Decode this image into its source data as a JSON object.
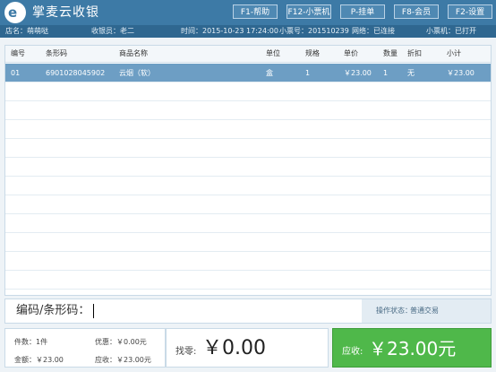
{
  "app": {
    "title": "掌麦云收银",
    "logo_icon": "logo-icon"
  },
  "function_keys": [
    {
      "label": "F1-帮助"
    },
    {
      "label": "F12-小票机"
    },
    {
      "label": "P-挂单"
    },
    {
      "label": "F8-会员"
    },
    {
      "label": "F2-设置"
    }
  ],
  "info": {
    "store": "店名：萌萌哒",
    "cashier": "收银员：老二",
    "time": "时间：2015-10-23 17:24:00",
    "ticket_no": "小票号：201510239",
    "network": "网络：已连接",
    "printer": "小票机：已打开"
  },
  "table": {
    "headers": [
      "编号",
      "条形码",
      "商品名称",
      "单位",
      "规格",
      "单价",
      "数量",
      "折扣",
      "小计"
    ],
    "rows": [
      {
        "no": "01",
        "barcode": "6901028045902",
        "name": "云烟（软）",
        "unit": "盒",
        "spec": "1",
        "price": "￥23.00",
        "qty": "1",
        "discount": "无",
        "subtotal": "￥23.00"
      }
    ]
  },
  "barcode_bar": {
    "label": "编码/条形码：",
    "status_label": "操作状态：",
    "status_value": "普通交易"
  },
  "summary": {
    "count": "件数：1件",
    "discount": "优惠：￥0.00元",
    "amount": "金额：￥23.00",
    "payable": "应收：￥23.00元",
    "change_label": "找零:",
    "change_value": "￥0.00",
    "due_label": "应收:",
    "due_value": "￥23.00元"
  },
  "colors": {
    "header": "#3d7aa6",
    "selected_row": "#6d9ec4",
    "due_box": "#4fb84a"
  }
}
